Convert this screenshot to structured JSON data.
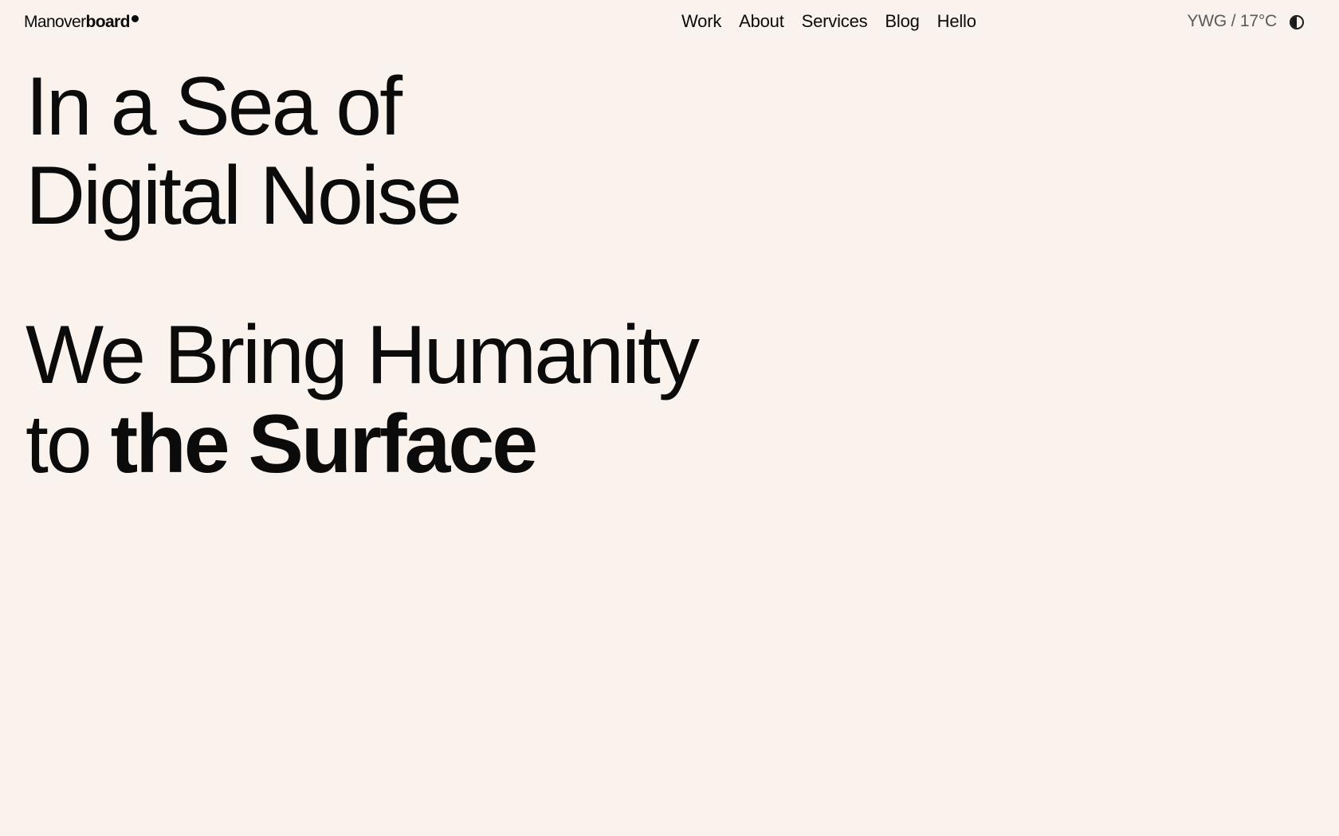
{
  "header": {
    "logo_light": "Manover",
    "logo_bold": "board",
    "nav": [
      "Work",
      "About",
      "Services",
      "Blog",
      "Hello"
    ],
    "weather": "YWG / 17°C"
  },
  "hero": {
    "line1": "In a Sea of",
    "line2": "Digital Noise",
    "line3": "We Bring Humanity",
    "line4_w1": "to",
    "line4_w2": "the",
    "line4_w3": "Surface"
  },
  "colors": {
    "background": "#f9f2ed",
    "text": "#0b0b0b",
    "muted": "#5a5a5a"
  },
  "icons": {
    "logo_dot": "filled-circle",
    "theme_toggle": "half-filled-circle"
  }
}
